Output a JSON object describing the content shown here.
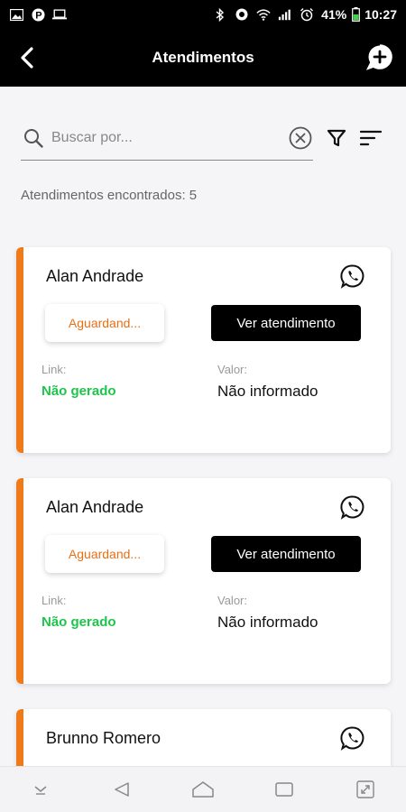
{
  "status_bar": {
    "battery": "41%",
    "time": "10:27"
  },
  "header": {
    "title": "Atendimentos",
    "back_icon": "chevron-left-icon",
    "new_icon": "chat-add-icon"
  },
  "search": {
    "placeholder": "Buscar por...",
    "value": ""
  },
  "results_label": "Atendimentos encontrados: 5",
  "cards": [
    {
      "name": "Alan Andrade",
      "status": "Aguardand...",
      "button": "Ver atendimento",
      "link_label": "Link:",
      "link_value": "Não gerado",
      "value_label": "Valor:",
      "value_value": "Não informado"
    },
    {
      "name": "Alan Andrade",
      "status": "Aguardand...",
      "button": "Ver atendimento",
      "link_label": "Link:",
      "link_value": "Não gerado",
      "value_label": "Valor:",
      "value_value": "Não informado"
    },
    {
      "name": "Brunno Romero"
    }
  ],
  "colors": {
    "accent": "#f07a1a",
    "status_text": "#e86f12",
    "link_green": "#1ec44b",
    "header_bg": "#000000"
  }
}
